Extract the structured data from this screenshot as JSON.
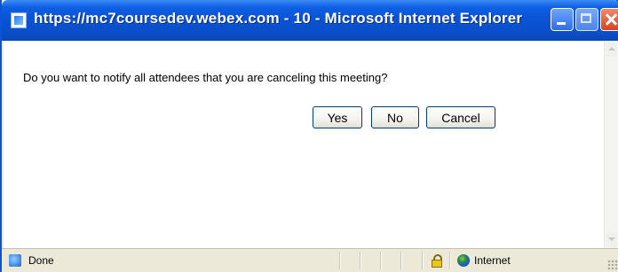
{
  "window": {
    "title": "https://mc7coursedev.webex.com - 10 - Microsoft Internet Explorer"
  },
  "dialog": {
    "message": "Do you want to notify all attendees that you are canceling this meeting?",
    "buttons": {
      "yes_label": "Yes",
      "no_label": "No",
      "cancel_label": "Cancel"
    }
  },
  "statusbar": {
    "status": "Done",
    "zone": "Internet"
  },
  "icons": {
    "title": "ie-page-icon",
    "minimize": "minimize-icon",
    "maximize": "maximize-icon",
    "close": "close-icon",
    "status_page": "ie-page-icon",
    "security": "lock-icon",
    "zone": "globe-icon"
  },
  "colors": {
    "titlebar": "#0a54d6",
    "close_button": "#d8431f",
    "button_border": "#003c74"
  }
}
